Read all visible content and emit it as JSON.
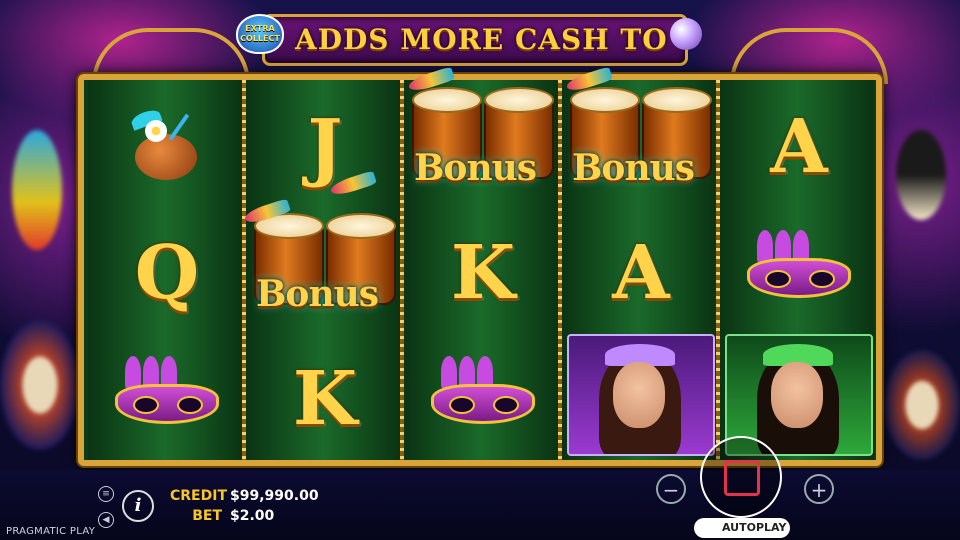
{
  "banner": {
    "badge_line1": "EXTRA",
    "badge_line2": "COLLECT",
    "text": "ADDS MORE CASH TO"
  },
  "reels": {
    "bonus_label": "Bonus",
    "symbols": {
      "letter_j": "J",
      "letter_q": "Q",
      "letter_k": "K",
      "letter_a": "A"
    }
  },
  "footer": {
    "credit_label": "CREDIT",
    "credit_value": "$99,990.00",
    "bet_label": "BET",
    "bet_value": "$2.00",
    "autoplay_label": "AUTOPLAY",
    "brand": "PRAGMATIC PLAY",
    "minus": "−",
    "plus": "+",
    "info": "i",
    "menu": "≡",
    "sound": "◀"
  },
  "colors": {
    "gold": "#f7c62a",
    "reel_green": "#1b6a2a",
    "banner_purple": "#6b1378"
  }
}
